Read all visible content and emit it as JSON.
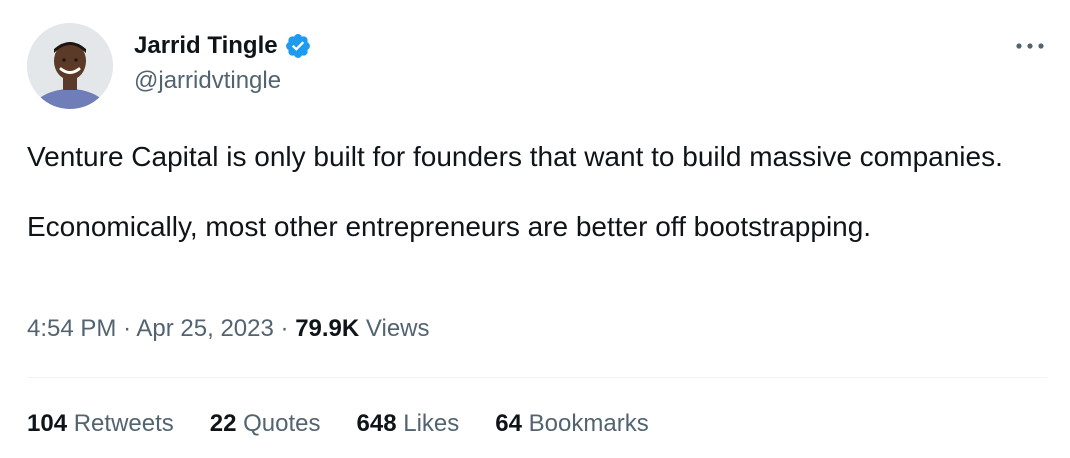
{
  "author": {
    "display_name": "Jarrid Tingle",
    "handle": "@jarridvtingle",
    "verified": true
  },
  "icons": {
    "verified": "verified-badge-icon",
    "more": "more-horizontal-icon"
  },
  "colors": {
    "verified": "#1d9bf0",
    "text": "#0f1419",
    "secondary": "#536471",
    "divider": "#eff3f4"
  },
  "tweet": {
    "paragraphs": [
      "Venture Capital is only built for founders that want to build massive companies.",
      "Economically, most other entrepreneurs are better off bootstrapping."
    ],
    "time": "4:54 PM",
    "separator": "·",
    "date": "Apr 25, 2023",
    "views_count": "79.9K",
    "views_label": "Views"
  },
  "stats": {
    "retweets": {
      "count": "104",
      "label": "Retweets"
    },
    "quotes": {
      "count": "22",
      "label": "Quotes"
    },
    "likes": {
      "count": "648",
      "label": "Likes"
    },
    "bookmarks": {
      "count": "64",
      "label": "Bookmarks"
    }
  }
}
